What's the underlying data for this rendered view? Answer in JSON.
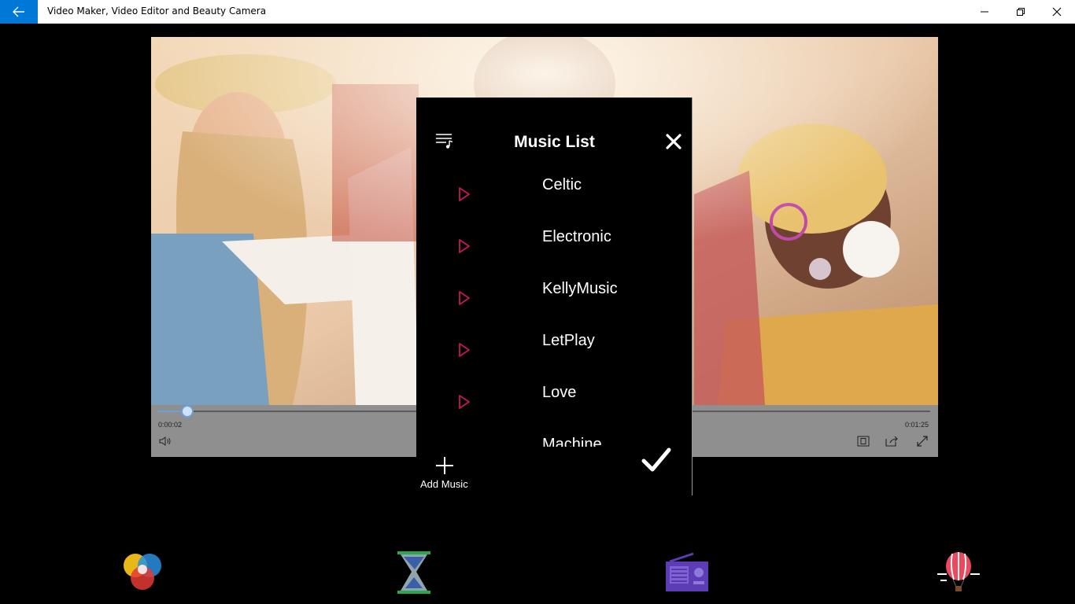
{
  "window": {
    "title": "Video Maker, Video Editor and Beauty Camera"
  },
  "player": {
    "current_time": "0:00:02",
    "total_time": "0:01:25",
    "progress_fraction": 0.04
  },
  "music_dialog": {
    "title": "Music List",
    "items": [
      {
        "label": "Celtic"
      },
      {
        "label": "Electronic"
      },
      {
        "label": "KellyMusic"
      },
      {
        "label": "LetPlay"
      },
      {
        "label": "Love"
      },
      {
        "label": "Machine"
      }
    ],
    "add_label": "Add Music"
  },
  "toolbar": {
    "tools": [
      "filters-icon",
      "duration-icon",
      "music-radio-icon",
      "balloon-icon"
    ]
  },
  "colors": {
    "accent": "#0078d7",
    "play_icon": "#c2185b",
    "radio": "#5c3db5",
    "hourglass": "#2aa84a"
  }
}
